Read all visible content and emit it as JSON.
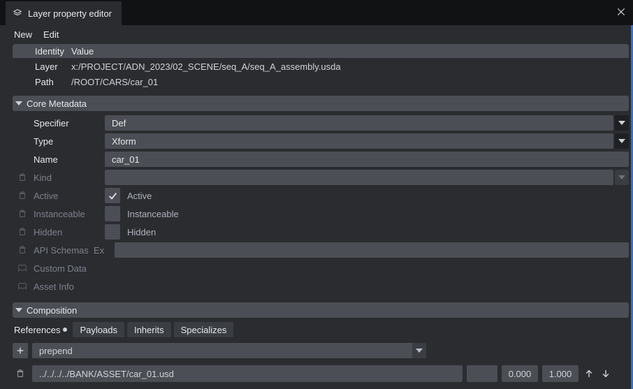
{
  "title": "Layer property editor",
  "menu": {
    "new": "New",
    "edit": "Edit"
  },
  "identity": {
    "head_identity": "Identity",
    "head_value": "Value",
    "layer_key": "Layer",
    "layer_val": "x:/PROJECT/ADN_2023/02_SCENE/seq_A/seq_A_assembly.usda",
    "path_key": "Path",
    "path_val": "/ROOT/CARS/car_01"
  },
  "sections": {
    "core": "Core Metadata",
    "composition": "Composition"
  },
  "core": {
    "specifier_label": "Specifier",
    "specifier_value": "Def",
    "type_label": "Type",
    "type_value": "Xform",
    "name_label": "Name",
    "name_value": "car_01",
    "kind_label": "Kind",
    "kind_value": "",
    "active_label": "Active",
    "active_chk_label": "Active",
    "instanceable_label": "Instanceable",
    "instanceable_chk_label": "Instanceable",
    "hidden_label": "Hidden",
    "hidden_chk_label": "Hidden",
    "apischemas_label": "API Schemas",
    "apischemas_ex": "Ex",
    "customdata_label": "Custom Data",
    "assetinfo_label": "Asset Info"
  },
  "composition": {
    "tabs": {
      "references": "References",
      "payloads": "Payloads",
      "inherits": "Inherits",
      "specializes": "Specializes"
    },
    "mode": "prepend",
    "ref_path": "../../../../BANK/ASSET/car_01.usd",
    "num1": "0.000",
    "num2": "1.000"
  }
}
